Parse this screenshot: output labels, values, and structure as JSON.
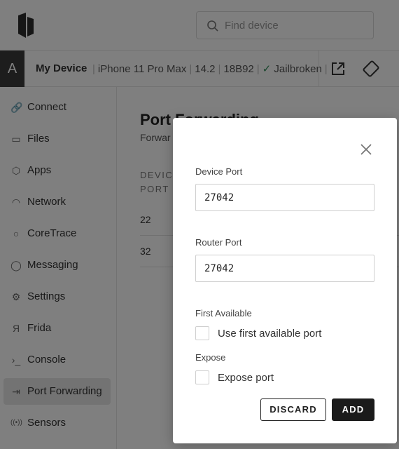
{
  "search": {
    "placeholder": "Find device"
  },
  "device": {
    "avatar_letter": "A",
    "name": "My Device",
    "model": "iPhone 11 Pro Max",
    "os_version": "14.2",
    "build": "18B92",
    "status_check": "✓",
    "status": "Jailbroken"
  },
  "sidebar": {
    "items": [
      {
        "label": "Connect",
        "icon": "link-icon",
        "glyph": "🔗"
      },
      {
        "label": "Files",
        "icon": "folder-icon",
        "glyph": "▭"
      },
      {
        "label": "Apps",
        "icon": "cube-icon",
        "glyph": "⬡"
      },
      {
        "label": "Network",
        "icon": "wifi-icon",
        "glyph": "◠"
      },
      {
        "label": "CoreTrace",
        "icon": "search-icon",
        "glyph": "○"
      },
      {
        "label": "Messaging",
        "icon": "chat-icon",
        "glyph": "◯"
      },
      {
        "label": "Settings",
        "icon": "gear-icon",
        "glyph": "⚙"
      },
      {
        "label": "Frida",
        "icon": "frida-icon",
        "glyph": "Я"
      },
      {
        "label": "Console",
        "icon": "terminal-icon",
        "glyph": "›_"
      },
      {
        "label": "Port Forwarding",
        "icon": "port-forward-icon",
        "glyph": "⇥"
      },
      {
        "label": "Sensors",
        "icon": "sensor-icon",
        "glyph": "((•))"
      }
    ]
  },
  "main": {
    "title": "Port Forwarding",
    "subtitle": "Forwar",
    "column_header": "DEVICE PORT",
    "rows": [
      "22",
      "32"
    ]
  },
  "modal": {
    "device_port_label": "Device Port",
    "device_port_value": "27042",
    "router_port_label": "Router Port",
    "router_port_value": "27042",
    "first_available_label": "First Available",
    "first_available_checkbox_label": "Use first available port",
    "expose_label": "Expose",
    "expose_checkbox_label": "Expose port",
    "discard_label": "DISCARD",
    "add_label": "ADD"
  },
  "colors": {
    "overlay": "#000000",
    "primary_button": "#1b1b1b",
    "jailbroken_check": "#2e8b57"
  }
}
